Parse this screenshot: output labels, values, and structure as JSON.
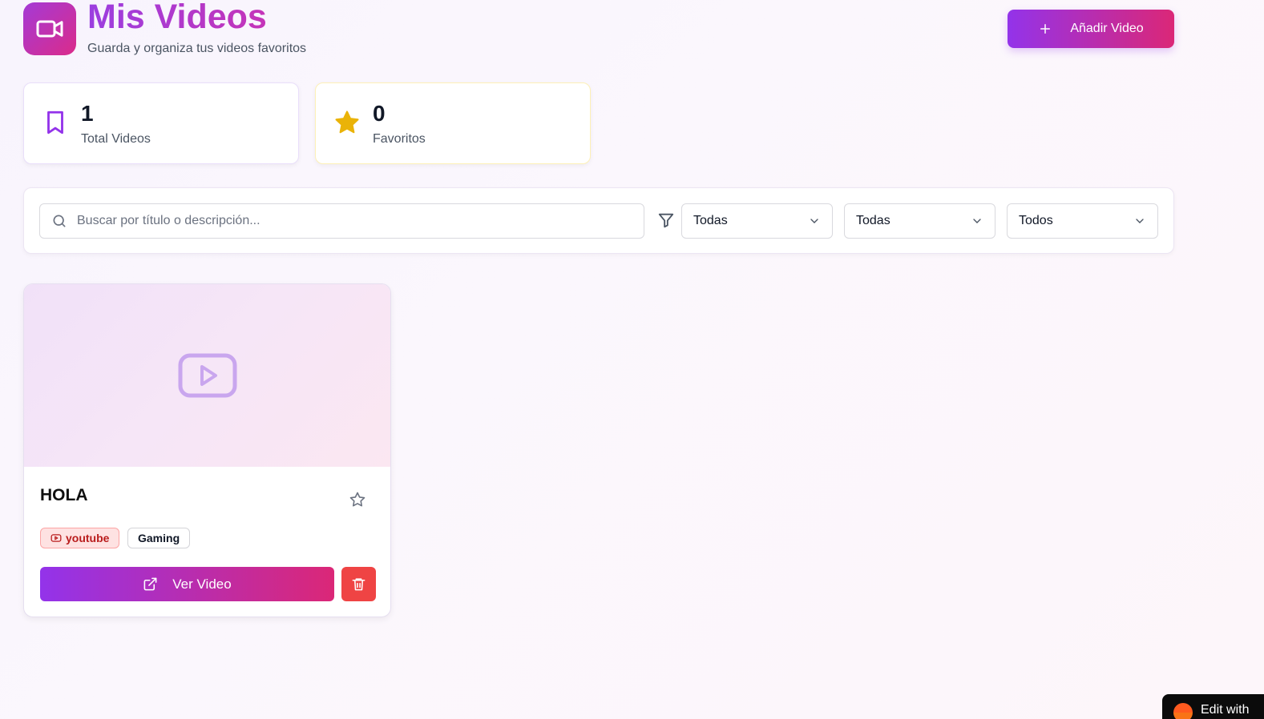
{
  "header": {
    "title": "Mis Videos",
    "subtitle": "Guarda y organiza tus videos favoritos",
    "add_button_label": "Añadir Video",
    "logo_icon": "video-camera-icon"
  },
  "stats": [
    {
      "value": "1",
      "label": "Total Videos",
      "icon": "bookmark-icon",
      "color": "#9333ea"
    },
    {
      "value": "0",
      "label": "Favoritos",
      "icon": "star-icon",
      "color": "#eab308"
    }
  ],
  "filters": {
    "search_placeholder": "Buscar por título o descripción...",
    "search_value": "",
    "selects": [
      "Todas",
      "Todas",
      "Todos"
    ]
  },
  "videos": [
    {
      "title": "HOLA",
      "platform": "youtube",
      "category": "Gaming",
      "is_favorite": false,
      "watch_label": "Ver Video"
    }
  ],
  "edit_widget": {
    "label": "Edit with"
  },
  "colors": {
    "accent_start": "#9333ea",
    "accent_end": "#db2777",
    "danger": "#ef4444",
    "star": "#eab308"
  }
}
